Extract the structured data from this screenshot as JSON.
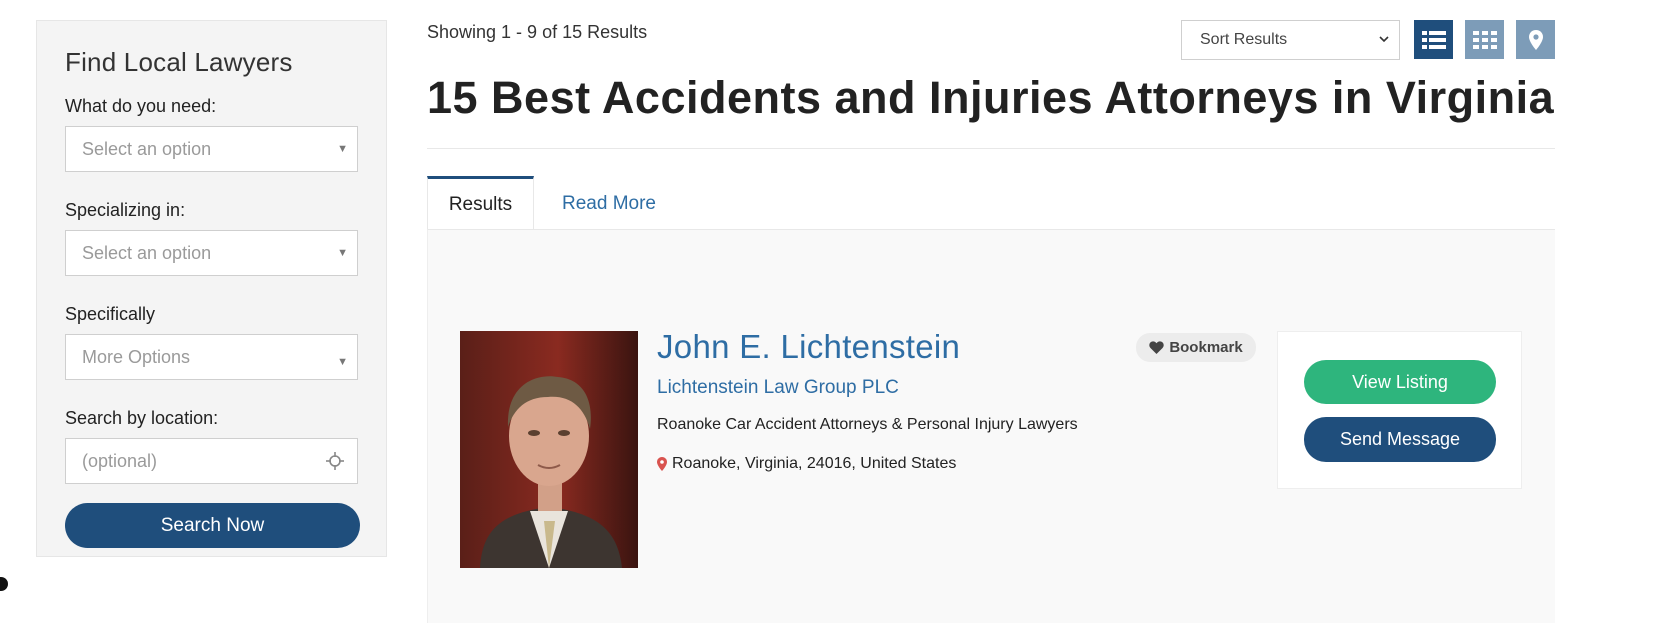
{
  "sidebar": {
    "title": "Find Local Lawyers",
    "need_label": "What do you need:",
    "need_value": "Select an option",
    "specializing_label": "Specializing in:",
    "specializing_value": "Select an option",
    "specifically_label": "Specifically",
    "specifically_value": "More Options",
    "location_label": "Search by location:",
    "location_placeholder": "(optional)",
    "search_button": "Search Now"
  },
  "results_header": {
    "showing": "Showing 1 - 9 of 15 Results",
    "sort_label": "Sort Results",
    "page_title": "15 Best Accidents and Injuries Attorneys in Virginia"
  },
  "tabs": [
    {
      "label": "Results",
      "active": true
    },
    {
      "label": "Read More",
      "active": false
    }
  ],
  "listing": {
    "name": "John E. Lichtenstein",
    "firm": "Lichtenstein Law Group PLC",
    "description": "Roanoke Car Accident Attorneys & Personal Injury Lawyers",
    "location": "Roanoke, Virginia, 24016, United States",
    "bookmark_label": "Bookmark",
    "view_listing": "View Listing",
    "send_message": "Send Message"
  },
  "colors": {
    "primary": "#1f4e7c",
    "link": "#2e6da4",
    "success": "#2eb57d",
    "pin": "#d9534f"
  },
  "icons": [
    "list-view-icon",
    "grid-view-icon",
    "map-view-icon",
    "crosshair-icon",
    "heart-icon",
    "map-pin-icon",
    "chevron-down-icon"
  ]
}
